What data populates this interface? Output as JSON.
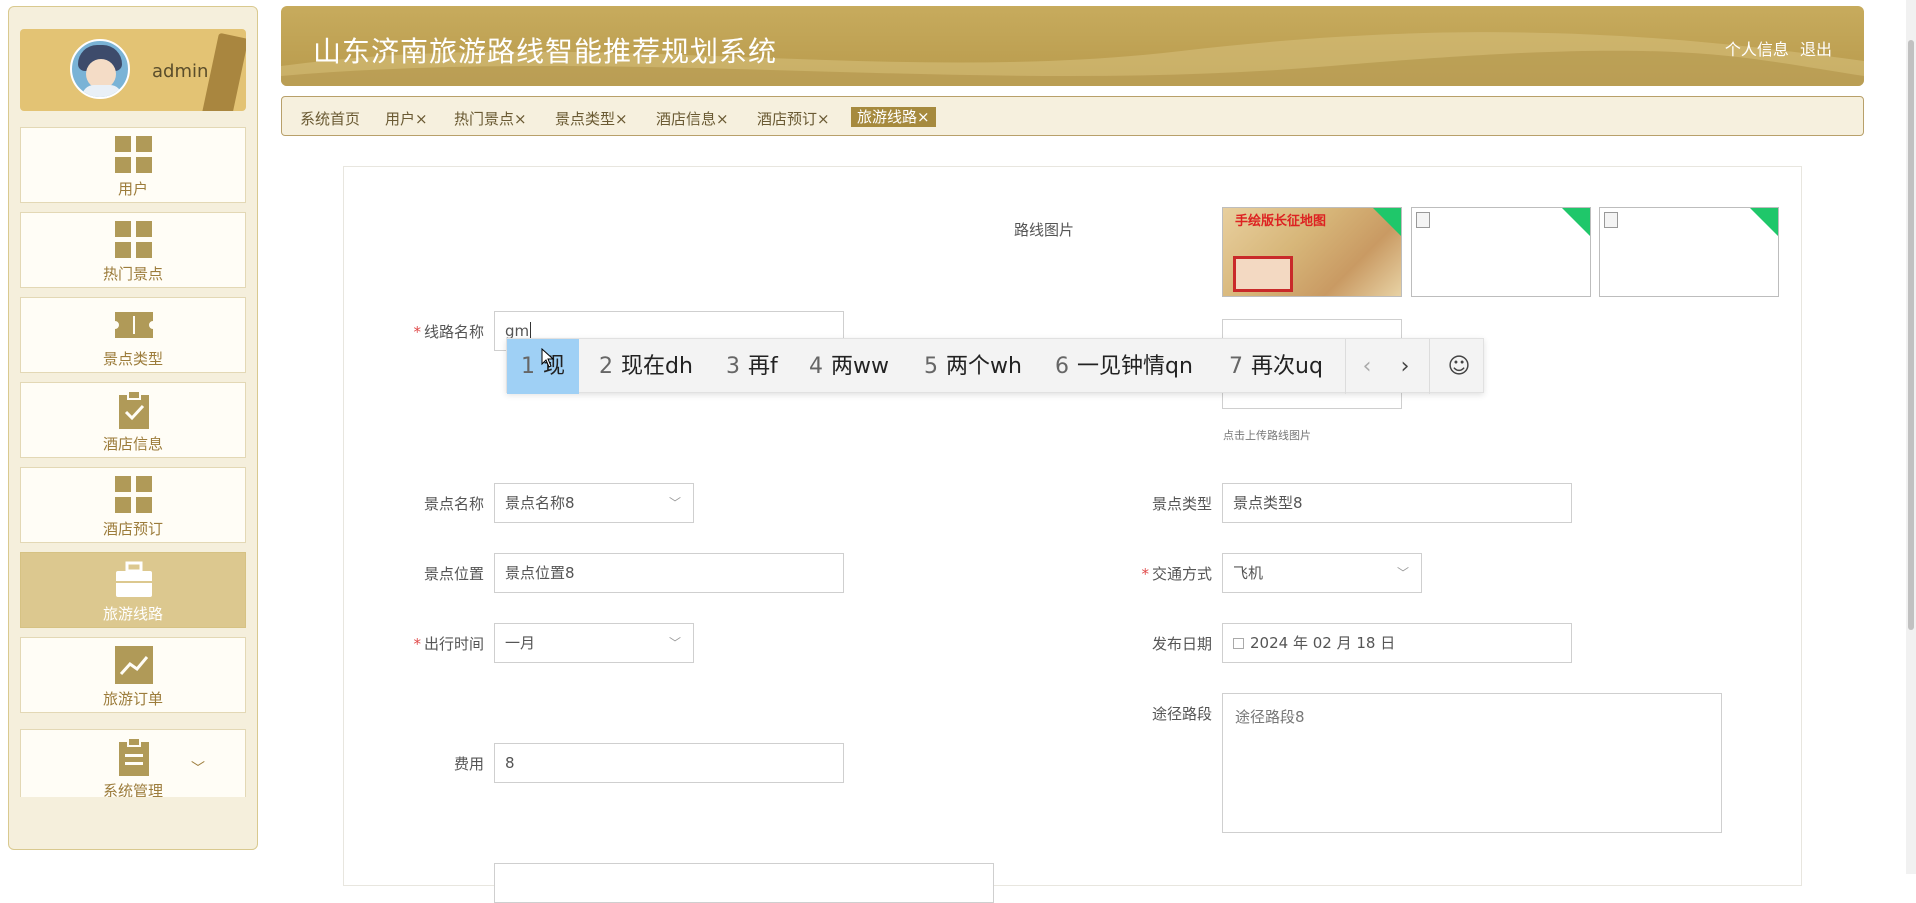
{
  "sidebar": {
    "user": {
      "name": "admin"
    },
    "items": [
      {
        "label": "用户",
        "icon": "grid-icon"
      },
      {
        "label": "热门景点",
        "icon": "grid-icon"
      },
      {
        "label": "景点类型",
        "icon": "ticket-icon"
      },
      {
        "label": "酒店信息",
        "icon": "clipboard-check-icon"
      },
      {
        "label": "酒店预订",
        "icon": "grid-icon"
      },
      {
        "label": "旅游线路",
        "icon": "briefcase-icon",
        "active": true
      },
      {
        "label": "旅游订单",
        "icon": "chart-line-icon"
      },
      {
        "label": "系统管理",
        "icon": "clipboard-list-icon"
      }
    ]
  },
  "header": {
    "title": "山东济南旅游路线智能推荐规划系统",
    "profile_link": "个人信息",
    "logout_link": "退出"
  },
  "tabs": [
    {
      "label": "系统首页",
      "closable": false
    },
    {
      "label": "用户",
      "closable": true
    },
    {
      "label": "热门景点",
      "closable": true
    },
    {
      "label": "景点类型",
      "closable": true
    },
    {
      "label": "酒店信息",
      "closable": true
    },
    {
      "label": "酒店预订",
      "closable": true
    },
    {
      "label": "旅游线路",
      "closable": true,
      "active": true
    }
  ],
  "close_glyph": "×",
  "form": {
    "route_image": {
      "label": "路线图片",
      "map_title": "手绘版长征地图",
      "hint": "点击上传路线图片"
    },
    "route_name": {
      "label": "线路名称",
      "value": "gm"
    },
    "spot_name": {
      "label": "景点名称",
      "value": "景点名称8"
    },
    "spot_type": {
      "label": "景点类型",
      "value": "景点类型8"
    },
    "spot_location": {
      "label": "景点位置",
      "value": "景点位置8"
    },
    "transport": {
      "label": "交通方式",
      "value": "飞机"
    },
    "travel_time": {
      "label": "出行时间",
      "value": "一月"
    },
    "publish_date": {
      "label": "发布日期",
      "value": "2024 年 02 月 18 日"
    },
    "route_path": {
      "label": "途径路段",
      "value": "途径路段8"
    },
    "cost": {
      "label": "费用",
      "value": "8"
    },
    "required_mark": "*"
  },
  "ime": {
    "candidates": [
      {
        "num": "1",
        "text": "现"
      },
      {
        "num": "2",
        "text": "现在dh"
      },
      {
        "num": "3",
        "text": "再f"
      },
      {
        "num": "4",
        "text": "两ww"
      },
      {
        "num": "5",
        "text": "两个wh"
      },
      {
        "num": "6",
        "text": "一见钟情qn"
      },
      {
        "num": "7",
        "text": "再次uq"
      }
    ],
    "prev": "‹",
    "next": "›",
    "emoji": "☺"
  },
  "colors": {
    "accent": "#b89a4c",
    "active_tab": "#a68a3e",
    "required": "#e04a4a"
  }
}
